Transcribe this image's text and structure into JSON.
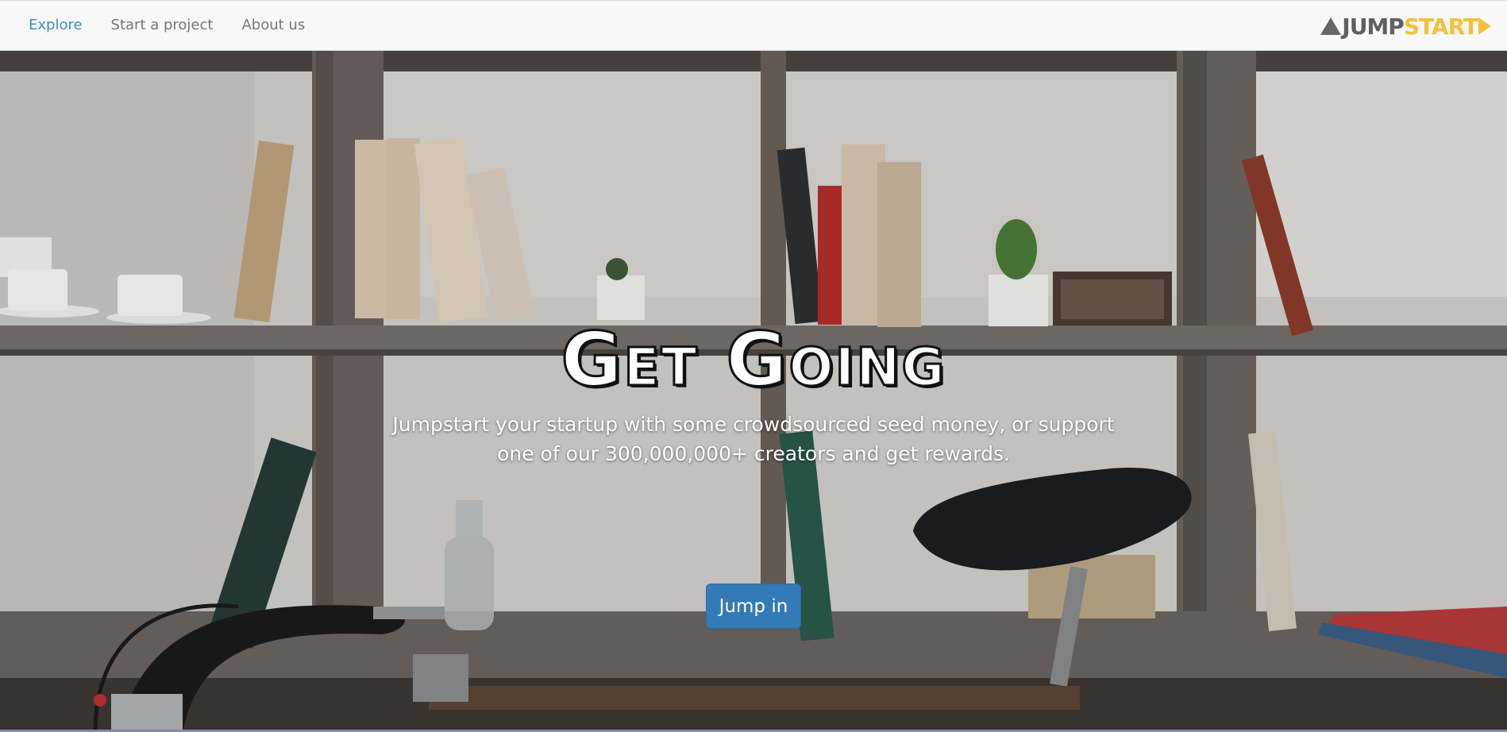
{
  "nav": {
    "items": [
      {
        "label": "Explore",
        "active": true
      },
      {
        "label": "Start a project",
        "active": false
      },
      {
        "label": "About us",
        "active": false
      }
    ],
    "brand": {
      "part1": "JUMP",
      "part2": "START"
    }
  },
  "hero": {
    "title": "Get Going",
    "subtitle_line1": "Jumpstart your startup with some crowdsourced seed money, or support",
    "subtitle_line2": "one of our 300,000,000+ creators and get rewards.",
    "cta_label": "Jump in"
  },
  "colors": {
    "nav_active": "#3a8fca",
    "nav_text": "#777777",
    "brand_dark": "#5f5f5f",
    "brand_accent": "#f3c23b",
    "cta_bg": "#337ab7"
  },
  "icons": {
    "brand_left": "triangle-icon",
    "brand_right": "play-arrow-icon"
  }
}
